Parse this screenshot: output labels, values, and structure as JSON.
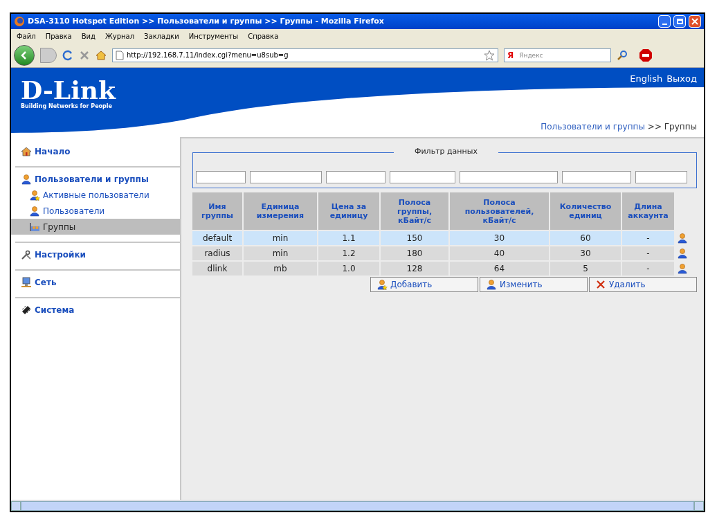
{
  "window": {
    "title": "DSA-3110 Hotspot Edition >> Пользователи и группы >> Группы - Mozilla Firefox"
  },
  "menu": [
    "Файл",
    "Правка",
    "Вид",
    "Журнал",
    "Закладки",
    "Инструменты",
    "Справка"
  ],
  "address_bar": {
    "value": "http://192.168.7.11/index.cgi?menu=u8sub=g"
  },
  "search": {
    "engine": "Я",
    "placeholder": "Яндекс"
  },
  "header": {
    "logo": "D-Link",
    "tagline": "Building Networks for People",
    "links": [
      "English",
      "Выход"
    ]
  },
  "breadcrumb": {
    "link": "Пользователи и группы",
    "current": ">> Группы"
  },
  "sidebar": {
    "items": [
      {
        "label": "Начало",
        "kind": "home",
        "selected": false
      },
      {
        "label": "Пользователи и группы",
        "kind": "user",
        "selected": false,
        "children": [
          {
            "label": "Активные пользователи",
            "kind": "user-star",
            "selected": false
          },
          {
            "label": "Пользователи",
            "kind": "user",
            "selected": false
          },
          {
            "label": "Группы",
            "kind": "group",
            "selected": true
          }
        ]
      },
      {
        "label": "Настройки",
        "kind": "tools",
        "selected": false
      },
      {
        "label": "Сеть",
        "kind": "network",
        "selected": false
      },
      {
        "label": "Система",
        "kind": "chip",
        "selected": false
      }
    ]
  },
  "filter": {
    "title": "Фильтр данных"
  },
  "table": {
    "columns": [
      "Имя группы",
      "Единица измерения",
      "Цена за единицу",
      "Полоса группы, кБайт/с",
      "Полоса пользователей, кБайт/с",
      "Количество единиц",
      "Длина аккаунта"
    ],
    "rows": [
      {
        "cells": [
          "default",
          "min",
          "1.1",
          "150",
          "30",
          "60",
          "-"
        ],
        "selected": true
      },
      {
        "cells": [
          "radius",
          "min",
          "1.2",
          "180",
          "40",
          "30",
          "-"
        ],
        "selected": false
      },
      {
        "cells": [
          "dlink",
          "mb",
          "1.0",
          "128",
          "64",
          "5",
          "-"
        ],
        "selected": false
      }
    ]
  },
  "buttons": [
    {
      "label": "Добавить",
      "kind": "add"
    },
    {
      "label": "Изменить",
      "kind": "edit"
    },
    {
      "label": "Удалить",
      "kind": "delete"
    }
  ]
}
